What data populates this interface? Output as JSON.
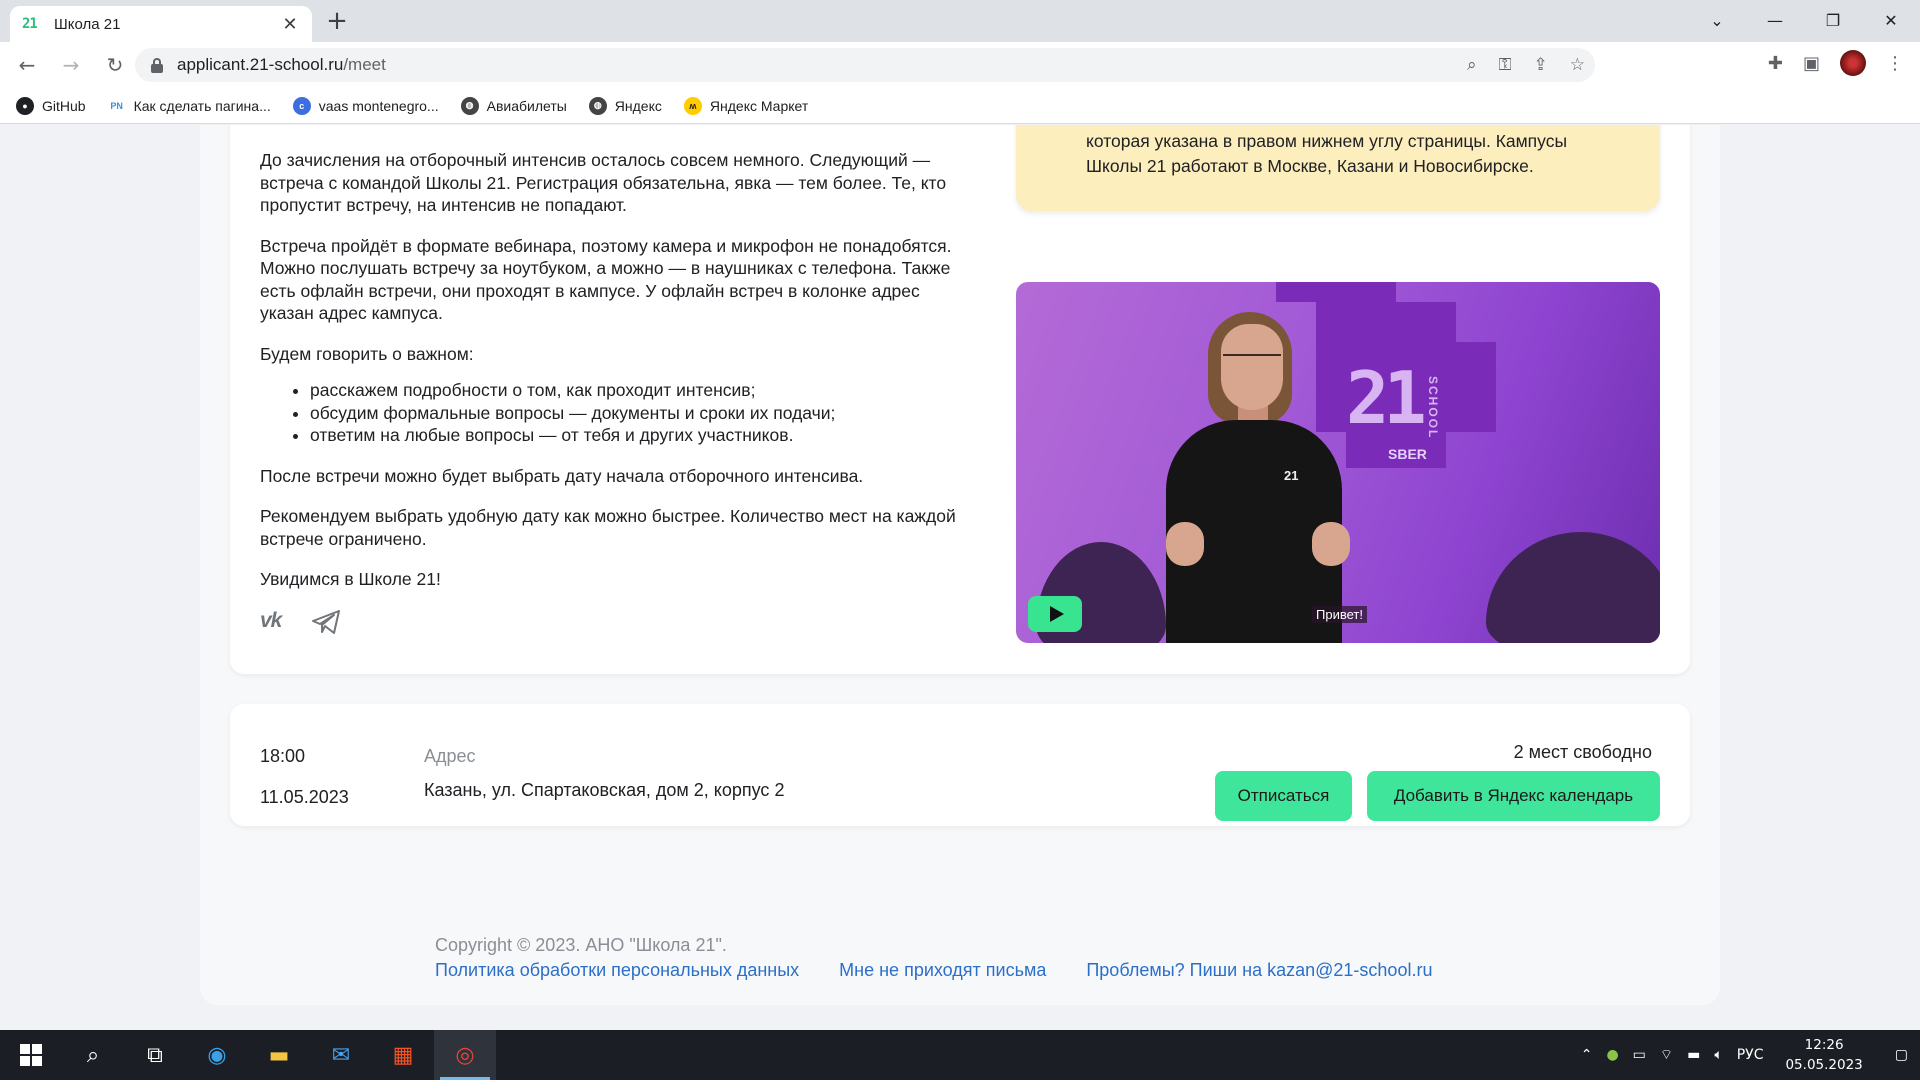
{
  "browser": {
    "tab_title": "Школа 21",
    "tab_favicon_text": "21",
    "url_host": "applicant.21-school.ru",
    "url_path": "/meet",
    "bookmarks": [
      {
        "label": "GitHub",
        "icon": "github-icon"
      },
      {
        "label": "Как сделать пагина...",
        "icon": "pn-icon"
      },
      {
        "label": "vaas montenegro...",
        "icon": "site-icon"
      },
      {
        "label": "Авиабилеты",
        "icon": "globe-icon"
      },
      {
        "label": "Яндекс",
        "icon": "globe-icon"
      },
      {
        "label": "Яндекс Маркет",
        "icon": "market-icon"
      }
    ]
  },
  "notice": {
    "text_line1": "которая указана в правом нижнем углу страницы. Кампусы",
    "text_line2": "Школы 21 работают в Москве, Казани и Новосибирске."
  },
  "article": {
    "p1": "До зачисления на отборочный интенсив осталось совсем немного. Следующий — встреча с командой Школы 21. Регистрация обязательна, явка — тем более. Те, кто пропустит встречу, на интенсив не попадают.",
    "p2": "Встреча пройдёт в формате вебинара, поэтому камера и микрофон не понадобятся. Можно послушать встречу за ноутбуком, а можно — в наушниках с телефона. Также есть офлайн встречи, они проходят в кампусе. У офлайн встреч в колонке адрес указан адрес кампуса.",
    "p3": "Будем говорить о важном:",
    "list": [
      "расскажем подробности о том, как проходит интенсив;",
      "обсудим формальные вопросы — документы и сроки их подачи;",
      "ответим на любые вопросы — от тебя и других участников."
    ],
    "p4": "После встречи можно будет выбрать дату начала отборочного интенсива.",
    "p5": "Рекомендуем выбрать удобную дату как можно быстрее. Количество мест на каждой встрече ограничено.",
    "p6": "Увидимся в Школе 21!",
    "social_vk": "vk"
  },
  "video": {
    "logo_text": "21",
    "school_text": "SCHOOL",
    "sber_text": "SBER",
    "shirt_logo": "21",
    "caption": "Привет!"
  },
  "meeting": {
    "time": "18:00",
    "date": "11.05.2023",
    "address_label": "Адрес",
    "address": "Казань, ул. Спартаковская, дом 2, корпус 2",
    "seats": "2 мест свободно",
    "unsubscribe_label": "Отписаться",
    "calendar_label": "Добавить в Яндекс календарь"
  },
  "footer": {
    "copyright": "Copyright © 2023. АНО \"Школа 21\".",
    "link_privacy": "Политика обработки персональных данных",
    "link_no_emails": "Мне не приходят письма",
    "link_problems": "Проблемы? Пиши на kazan@21-school.ru"
  },
  "taskbar": {
    "lang": "РУС",
    "time": "12:26",
    "date": "05.05.2023"
  },
  "colors": {
    "accent_green": "#3ee59b",
    "notice_bg": "#fdeebe",
    "link_blue": "#2b6fc9"
  }
}
